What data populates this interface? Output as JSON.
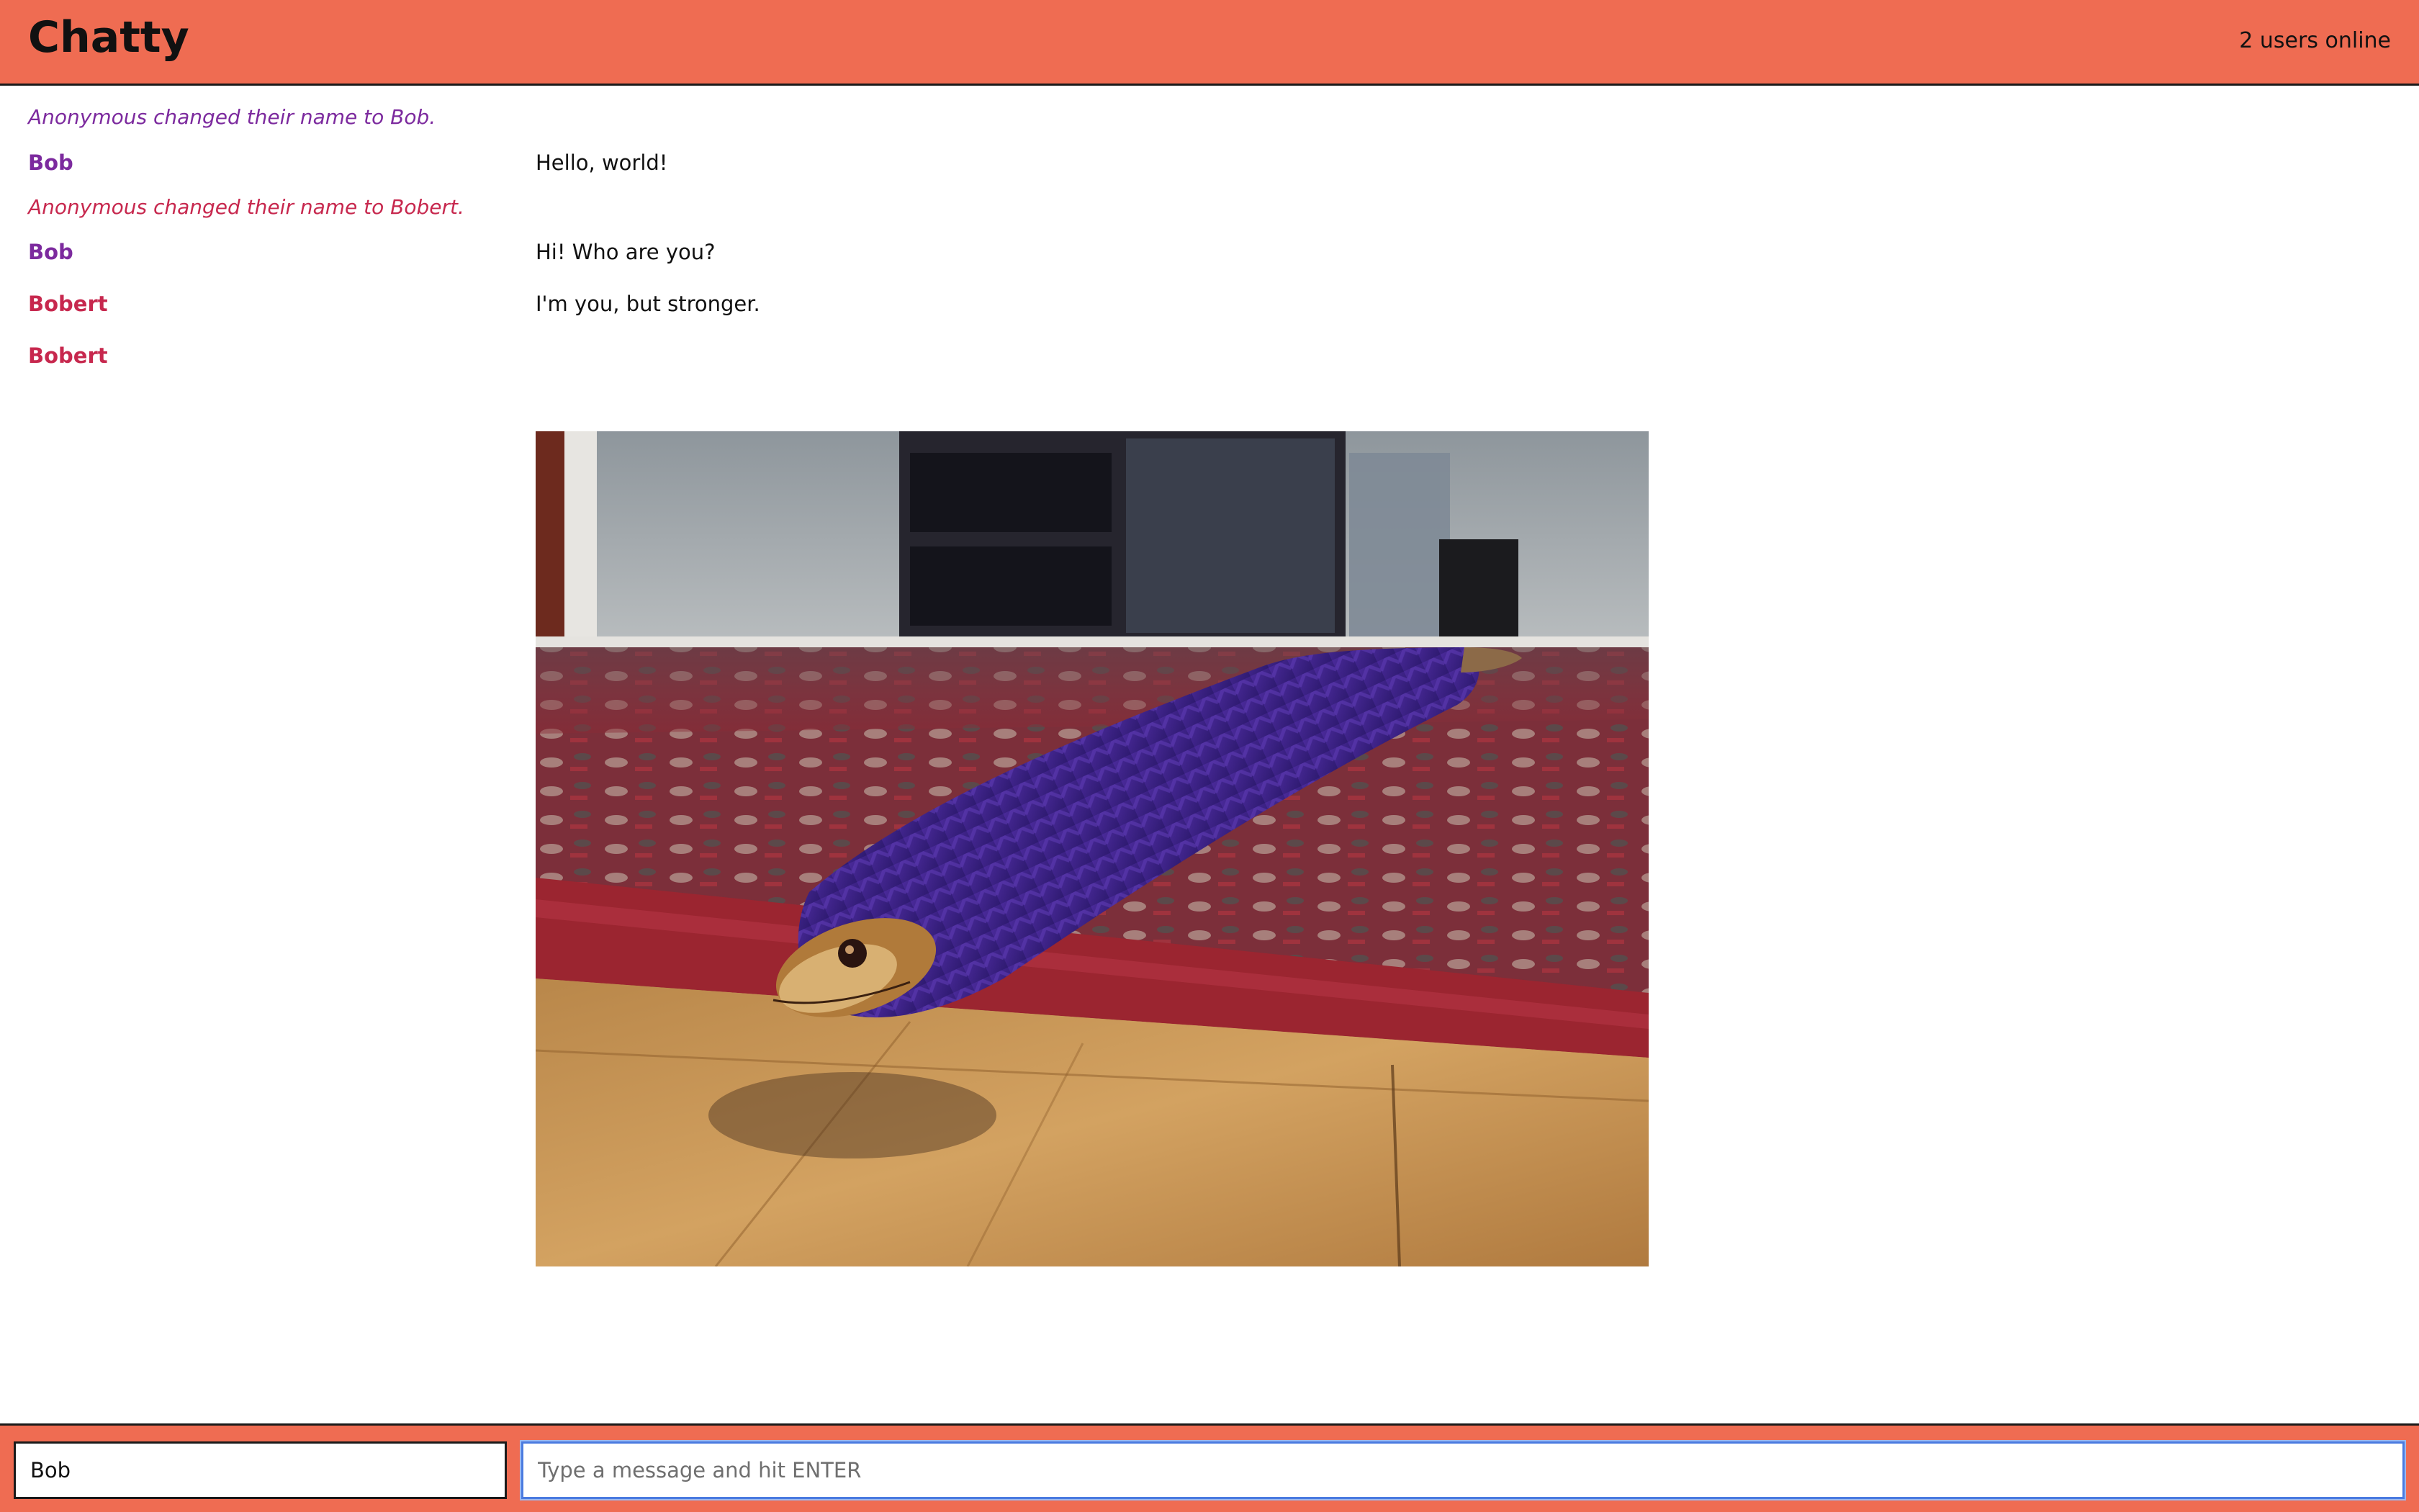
{
  "app": {
    "title": "Chatty",
    "users_online": "2 users online"
  },
  "colors": {
    "navbar_bg": "#ef6c52",
    "bob": "#7c2a9e",
    "bobert": "#c7284e",
    "input_focus": "#4a7be0"
  },
  "messages": [
    {
      "type": "notification",
      "text": "Anonymous changed their name to Bob.",
      "color": "#7c2a9e"
    },
    {
      "type": "message",
      "username": "Bob",
      "content": "Hello, world!",
      "color": "#7c2a9e"
    },
    {
      "type": "notification",
      "text": "Anonymous changed their name to Bobert.",
      "color": "#c7284e"
    },
    {
      "type": "message",
      "username": "Bob",
      "content": "Hi! Who are you?",
      "color": "#7c2a9e"
    },
    {
      "type": "message",
      "username": "Bobert",
      "content": "I'm you, but stronger.",
      "color": "#c7284e"
    },
    {
      "type": "image",
      "username": "Bobert",
      "color": "#c7284e"
    }
  ],
  "chatbar": {
    "username_value": "Bob",
    "message_placeholder": "Type a message and hit ENTER"
  }
}
